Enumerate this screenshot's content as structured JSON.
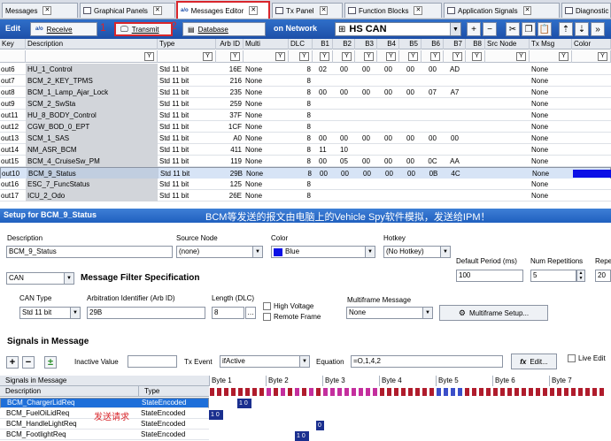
{
  "tabs": [
    {
      "label": "Messages",
      "active": false
    },
    {
      "label": "Graphical Panels",
      "active": false
    },
    {
      "label": "Messages Editor",
      "active": true
    },
    {
      "label": "Tx Panel",
      "active": false
    },
    {
      "label": "Function Blocks",
      "active": false
    },
    {
      "label": "Application Signals",
      "active": false
    },
    {
      "label": "Diagnostic",
      "active": false
    }
  ],
  "toolbar": {
    "edit_label": "Edit",
    "receive_label": "Receive",
    "transmit_label": "Transmit",
    "database_label": "Database",
    "on_network_label": "on Network",
    "network_value": "HS CAN",
    "annotation_1": "1",
    "annotation_2": "2"
  },
  "columns": [
    "Key",
    "Description",
    "Type",
    "Arb ID",
    "Multi",
    "DLC",
    "B1",
    "B2",
    "B3",
    "B4",
    "B5",
    "B6",
    "B7",
    "B8",
    "Src Node",
    "Tx Msg",
    "Color"
  ],
  "filter_icon": "Y",
  "messages": [
    {
      "key": "out6",
      "desc": "HU_1_Control",
      "type": "Std 11 bit",
      "arb": "16E",
      "multi": "None",
      "dlc": "8",
      "b": [
        "02",
        "00",
        "00",
        "00",
        "00",
        "00",
        "AD",
        ""
      ],
      "tx": "None",
      "sel": false
    },
    {
      "key": "out7",
      "desc": "BCM_2_KEY_TPMS",
      "type": "Std 11 bit",
      "arb": "216",
      "multi": "None",
      "dlc": "8",
      "b": [
        "",
        "",
        "",
        "",
        "",
        "",
        "",
        ""
      ],
      "tx": "None",
      "sel": false
    },
    {
      "key": "out8",
      "desc": "BCM_1_Lamp_Ajar_Lock",
      "type": "Std 11 bit",
      "arb": "235",
      "multi": "None",
      "dlc": "8",
      "b": [
        "00",
        "00",
        "00",
        "00",
        "00",
        "07",
        "A7",
        ""
      ],
      "tx": "None",
      "sel": false
    },
    {
      "key": "out9",
      "desc": "SCM_2_SwSta",
      "type": "Std 11 bit",
      "arb": "259",
      "multi": "None",
      "dlc": "8",
      "b": [
        "",
        "",
        "",
        "",
        "",
        "",
        "",
        ""
      ],
      "tx": "None",
      "sel": false
    },
    {
      "key": "out11",
      "desc": "HU_8_BODY_Control",
      "type": "Std 11 bit",
      "arb": "37F",
      "multi": "None",
      "dlc": "8",
      "b": [
        "",
        "",
        "",
        "",
        "",
        "",
        "",
        ""
      ],
      "tx": "None",
      "sel": false
    },
    {
      "key": "out12",
      "desc": "CGW_BOD_0_EPT",
      "type": "Std 11 bit",
      "arb": "1CF",
      "multi": "None",
      "dlc": "8",
      "b": [
        "",
        "",
        "",
        "",
        "",
        "",
        "",
        ""
      ],
      "tx": "None",
      "sel": false
    },
    {
      "key": "out13",
      "desc": "SCM_1_SAS",
      "type": "Std 11 bit",
      "arb": "A0",
      "multi": "None",
      "dlc": "8",
      "b": [
        "00",
        "00",
        "00",
        "00",
        "00",
        "00",
        "00",
        ""
      ],
      "tx": "None",
      "sel": false
    },
    {
      "key": "out14",
      "desc": "NM_ASR_BCM",
      "type": "Std 11 bit",
      "arb": "411",
      "multi": "None",
      "dlc": "8",
      "b": [
        "11",
        "10",
        "",
        "",
        "",
        "",
        "",
        ""
      ],
      "tx": "None",
      "sel": false
    },
    {
      "key": "out15",
      "desc": "BCM_4_CruiseSw_PM",
      "type": "Std 11 bit",
      "arb": "119",
      "multi": "None",
      "dlc": "8",
      "b": [
        "00",
        "05",
        "00",
        "00",
        "00",
        "0C",
        "AA",
        ""
      ],
      "tx": "None",
      "sel": false
    },
    {
      "key": "out10",
      "desc": "BCM_9_Status",
      "type": "Std 11 bit",
      "arb": "29B",
      "multi": "None",
      "dlc": "8",
      "b": [
        "00",
        "00",
        "00",
        "00",
        "00",
        "0B",
        "4C",
        ""
      ],
      "tx": "None",
      "sel": true
    },
    {
      "key": "out16",
      "desc": "ESC_7_FuncStatus",
      "type": "Std 11 bit",
      "arb": "125",
      "multi": "None",
      "dlc": "8",
      "b": [
        "",
        "",
        "",
        "",
        "",
        "",
        "",
        ""
      ],
      "tx": "None",
      "sel": false
    },
    {
      "key": "out17",
      "desc": "ICU_2_Odo",
      "type": "Std 11 bit",
      "arb": "26E",
      "multi": "None",
      "dlc": "8",
      "b": [
        "",
        "",
        "",
        "",
        "",
        "",
        "",
        ""
      ],
      "tx": "None",
      "sel": false
    }
  ],
  "setup": {
    "title": "Setup for BCM_9_Status",
    "note": "BCM等发送的报文由电脑上的Vehicle Spy软件模拟，发送给IPM！",
    "description_label": "Description",
    "description_value": "BCM_9_Status",
    "source_node_label": "Source Node",
    "source_node_value": "(none)",
    "color_label": "Color",
    "color_value": "Blue",
    "color_swatch": "#0b10e6",
    "hotkey_label": "Hotkey",
    "hotkey_value": "(No Hotkey)",
    "default_period_label": "Default Period (ms)",
    "default_period_value": "100",
    "num_rep_label": "Num Repetitions",
    "num_rep_value": "5",
    "rep_label": "Repe",
    "rep_value": "20",
    "protocol_value": "CAN",
    "filter_spec_label": "Message Filter Specification",
    "can_type_label": "CAN Type",
    "can_type_value": "Std 11 bit",
    "arb_label": "Arbitration Identifier (Arb ID)",
    "arb_value": "29B",
    "length_label": "Length (DLC)",
    "length_value": "8",
    "high_voltage_label": "High Voltage",
    "remote_frame_label": "Remote Frame",
    "multiframe_label": "Multiframe Message",
    "multiframe_value": "None",
    "multiframe_button": "Multiframe Setup..."
  },
  "signals": {
    "title": "Signals in Message",
    "inactive_value_label": "Inactive Value",
    "tx_event_label": "Tx Event",
    "tx_event_value": "ifActive",
    "equation_label": "Equation",
    "equation_value": "=O,1,4,2",
    "edit_button": "Edit...",
    "live_edit_label": "Live Edit",
    "list_header": "Signals in Message",
    "col_description": "Description",
    "col_type": "Type",
    "annotation": "发送请求",
    "items": [
      {
        "name": "BCM_ChargerLidReq",
        "type": "StateEncoded",
        "sel": true
      },
      {
        "name": "BCM_FuelOiLidReq",
        "type": "StateEncoded",
        "sel": false
      },
      {
        "name": "BCM_HandleLightReq",
        "type": "StateEncoded",
        "sel": false
      },
      {
        "name": "BCM_FootlightReq",
        "type": "StateEncoded",
        "sel": false
      }
    ],
    "bytes": [
      "Byte 1",
      "Byte 2",
      "Byte 3",
      "Byte 4",
      "Byte 5",
      "Byte 6",
      "Byte 7"
    ],
    "bits_row1": "10",
    "bits_row2": "10",
    "bits_row3": "0",
    "bits_row4": "10"
  },
  "colors": {
    "accent": "#1e6fd9",
    "highlight_red": "#d9262b",
    "bit_red": "#b01c2c",
    "bit_magenta": "#c42f9e",
    "bit_blue": "#3b4fc9"
  }
}
